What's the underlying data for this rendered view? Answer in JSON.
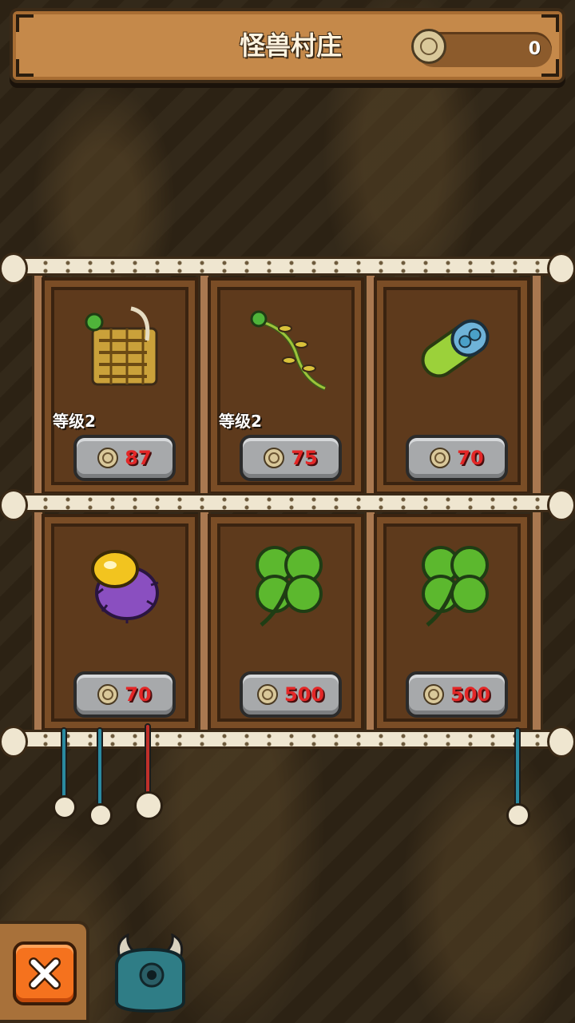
{
  "header": {
    "title": "怪兽村庄",
    "coin_icon": "coin-icon",
    "coin_count": "0"
  },
  "shop": {
    "items": [
      {
        "name": "gold-treasure-pile",
        "level": "等级2",
        "price": "87",
        "currency_icon": "coin-icon"
      },
      {
        "name": "lucky-clover-vine",
        "level": "等级2",
        "price": "75",
        "currency_icon": "coin-icon"
      },
      {
        "name": "green-capsule-pill",
        "level": "",
        "price": "70",
        "currency_icon": "coin-icon"
      },
      {
        "name": "purple-spore-creature",
        "level": "",
        "price": "70",
        "currency_icon": "coin-icon"
      },
      {
        "name": "four-leaf-clover",
        "level": "",
        "price": "500",
        "currency_icon": "coin-icon"
      },
      {
        "name": "four-leaf-clover",
        "level": "",
        "price": "500",
        "currency_icon": "coin-icon"
      }
    ]
  },
  "footer": {
    "close_icon": "close-icon",
    "monster_icon": "horned-monster-icon"
  },
  "colors": {
    "header_wood": "#c5894a",
    "price_red": "#e32727",
    "close_orange": "#f5721e",
    "button_gray": "#a7a9ab"
  }
}
